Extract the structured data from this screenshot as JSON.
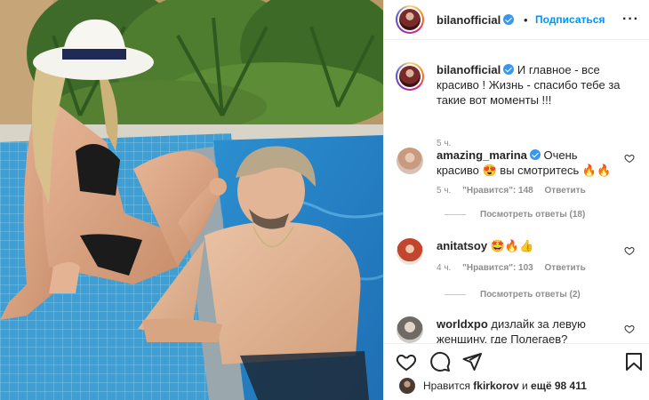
{
  "post": {
    "author": "bilanofficial",
    "follow_label": "Подписаться",
    "dot": "•",
    "more": "···",
    "caption": "И главное - все красиво ! Жизнь - спасибо тебе за такие вот моменты !!!",
    "caption_time": "5 ч."
  },
  "comments": [
    {
      "username": "amazing_marina",
      "verified": true,
      "text": "Очень красиво 😍 вы смотритесь 🔥🔥",
      "time": "5 ч.",
      "likes": "\"Нравится\": 148",
      "reply_label": "Ответить",
      "view_replies": "Посмотреть ответы (18)"
    },
    {
      "username": "anitatsoy",
      "verified": false,
      "text": "🤩🔥👍",
      "time": "4 ч.",
      "likes": "\"Нравится\": 103",
      "reply_label": "Ответить",
      "view_replies": "Посмотреть ответы (2)"
    },
    {
      "username": "worldxpo",
      "verified": false,
      "text": "дизлайк за левую женщину, где Полегаев?",
      "time": "",
      "likes": "",
      "view_replies": ""
    }
  ],
  "likes_summary": {
    "prefix": "Нравится",
    "user": "fkirkorov",
    "connector": "и",
    "rest": "ещё 98 411"
  },
  "icons": {
    "like": "heart-icon",
    "comment": "comment-icon",
    "share": "paper-plane-icon",
    "save": "bookmark-icon",
    "more": "more-dots-icon",
    "verified": "verified-badge-icon"
  },
  "colors": {
    "link_blue": "#0095f6",
    "verified_blue": "#3897f0",
    "meta_gray": "#8e8e8e",
    "text": "#262626"
  }
}
